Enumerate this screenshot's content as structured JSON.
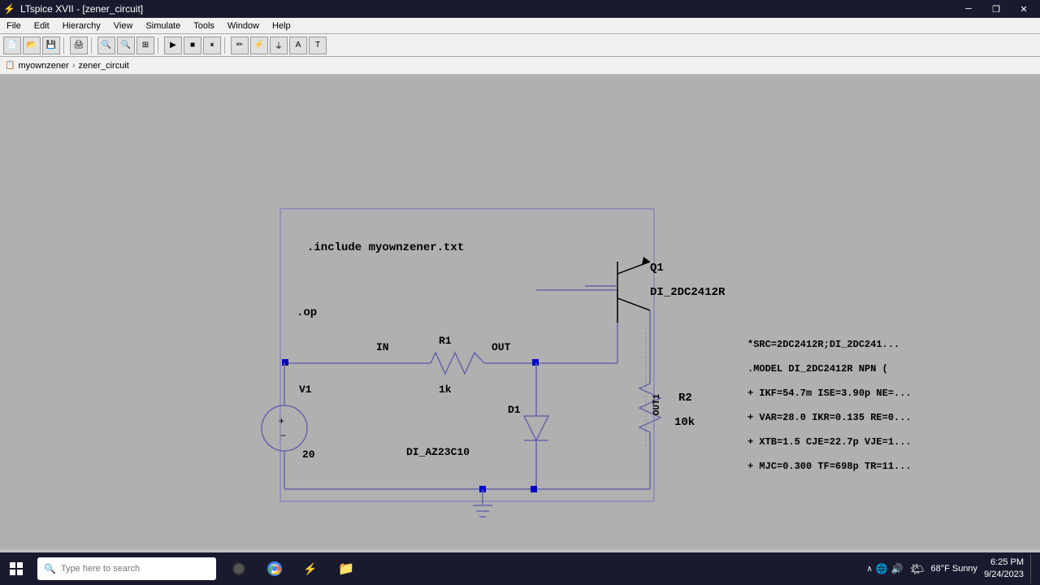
{
  "titlebar": {
    "title": "LTspice XVII - [zener_circuit]",
    "minimize_label": "─",
    "restore_label": "❐",
    "close_label": "✕"
  },
  "menubar": {
    "items": [
      "File",
      "Edit",
      "Hierarchy",
      "View",
      "Simulate",
      "Tools",
      "Window",
      "Help"
    ]
  },
  "breadcrumb": {
    "parent": "myownzener",
    "child": "zener_circuit"
  },
  "circuit": {
    "include_directive": ".include myownzener.txt",
    "op_directive": ".op",
    "v1_label": "V1",
    "v1_value": "20",
    "r1_label": "R1",
    "r1_value": "1k",
    "in_label": "IN",
    "out_label": "OUT",
    "d1_label": "D1",
    "d1_model": "DI_AZ23C10",
    "q1_label": "Q1",
    "q1_model": "DI_2DC2412R",
    "r2_label": "R2",
    "r2_value": "10k",
    "out1_label": "OUT1",
    "model_text_1": "*SRC=2DC2412R;DI_2DC241...",
    "model_text_2": ".MODEL DI_2DC2412R  NPN (",
    "model_text_3": "+ IKF=54.7m ISE=3.90p NE=...",
    "model_text_4": "+ VAR=28.0 IKR=0.135 RE=0...",
    "model_text_5": "+ XTB=1.5 CJE=22.7p VJE=1...",
    "model_text_6": "+ MJC=0.300 TF=698p TR=11..."
  },
  "taskbar": {
    "search_placeholder": "Type here to search",
    "weather": "68°F Sunny",
    "time": "6:25 PM",
    "date": "9/24/2023"
  }
}
